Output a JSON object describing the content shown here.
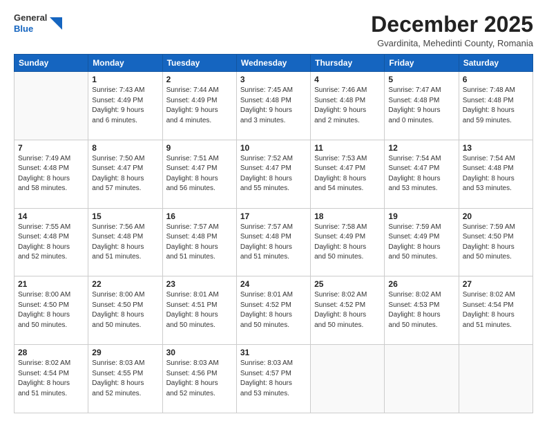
{
  "header": {
    "logo_line1": "General",
    "logo_line2": "Blue",
    "month_title": "December 2025",
    "location": "Gvardinita, Mehedinti County, Romania"
  },
  "weekdays": [
    "Sunday",
    "Monday",
    "Tuesday",
    "Wednesday",
    "Thursday",
    "Friday",
    "Saturday"
  ],
  "weeks": [
    [
      {
        "day": "",
        "info": ""
      },
      {
        "day": "1",
        "info": "Sunrise: 7:43 AM\nSunset: 4:49 PM\nDaylight: 9 hours\nand 6 minutes."
      },
      {
        "day": "2",
        "info": "Sunrise: 7:44 AM\nSunset: 4:49 PM\nDaylight: 9 hours\nand 4 minutes."
      },
      {
        "day": "3",
        "info": "Sunrise: 7:45 AM\nSunset: 4:48 PM\nDaylight: 9 hours\nand 3 minutes."
      },
      {
        "day": "4",
        "info": "Sunrise: 7:46 AM\nSunset: 4:48 PM\nDaylight: 9 hours\nand 2 minutes."
      },
      {
        "day": "5",
        "info": "Sunrise: 7:47 AM\nSunset: 4:48 PM\nDaylight: 9 hours\nand 0 minutes."
      },
      {
        "day": "6",
        "info": "Sunrise: 7:48 AM\nSunset: 4:48 PM\nDaylight: 8 hours\nand 59 minutes."
      }
    ],
    [
      {
        "day": "7",
        "info": "Sunrise: 7:49 AM\nSunset: 4:48 PM\nDaylight: 8 hours\nand 58 minutes."
      },
      {
        "day": "8",
        "info": "Sunrise: 7:50 AM\nSunset: 4:47 PM\nDaylight: 8 hours\nand 57 minutes."
      },
      {
        "day": "9",
        "info": "Sunrise: 7:51 AM\nSunset: 4:47 PM\nDaylight: 8 hours\nand 56 minutes."
      },
      {
        "day": "10",
        "info": "Sunrise: 7:52 AM\nSunset: 4:47 PM\nDaylight: 8 hours\nand 55 minutes."
      },
      {
        "day": "11",
        "info": "Sunrise: 7:53 AM\nSunset: 4:47 PM\nDaylight: 8 hours\nand 54 minutes."
      },
      {
        "day": "12",
        "info": "Sunrise: 7:54 AM\nSunset: 4:47 PM\nDaylight: 8 hours\nand 53 minutes."
      },
      {
        "day": "13",
        "info": "Sunrise: 7:54 AM\nSunset: 4:48 PM\nDaylight: 8 hours\nand 53 minutes."
      }
    ],
    [
      {
        "day": "14",
        "info": "Sunrise: 7:55 AM\nSunset: 4:48 PM\nDaylight: 8 hours\nand 52 minutes."
      },
      {
        "day": "15",
        "info": "Sunrise: 7:56 AM\nSunset: 4:48 PM\nDaylight: 8 hours\nand 51 minutes."
      },
      {
        "day": "16",
        "info": "Sunrise: 7:57 AM\nSunset: 4:48 PM\nDaylight: 8 hours\nand 51 minutes."
      },
      {
        "day": "17",
        "info": "Sunrise: 7:57 AM\nSunset: 4:48 PM\nDaylight: 8 hours\nand 51 minutes."
      },
      {
        "day": "18",
        "info": "Sunrise: 7:58 AM\nSunset: 4:49 PM\nDaylight: 8 hours\nand 50 minutes."
      },
      {
        "day": "19",
        "info": "Sunrise: 7:59 AM\nSunset: 4:49 PM\nDaylight: 8 hours\nand 50 minutes."
      },
      {
        "day": "20",
        "info": "Sunrise: 7:59 AM\nSunset: 4:50 PM\nDaylight: 8 hours\nand 50 minutes."
      }
    ],
    [
      {
        "day": "21",
        "info": "Sunrise: 8:00 AM\nSunset: 4:50 PM\nDaylight: 8 hours\nand 50 minutes."
      },
      {
        "day": "22",
        "info": "Sunrise: 8:00 AM\nSunset: 4:50 PM\nDaylight: 8 hours\nand 50 minutes."
      },
      {
        "day": "23",
        "info": "Sunrise: 8:01 AM\nSunset: 4:51 PM\nDaylight: 8 hours\nand 50 minutes."
      },
      {
        "day": "24",
        "info": "Sunrise: 8:01 AM\nSunset: 4:52 PM\nDaylight: 8 hours\nand 50 minutes."
      },
      {
        "day": "25",
        "info": "Sunrise: 8:02 AM\nSunset: 4:52 PM\nDaylight: 8 hours\nand 50 minutes."
      },
      {
        "day": "26",
        "info": "Sunrise: 8:02 AM\nSunset: 4:53 PM\nDaylight: 8 hours\nand 50 minutes."
      },
      {
        "day": "27",
        "info": "Sunrise: 8:02 AM\nSunset: 4:54 PM\nDaylight: 8 hours\nand 51 minutes."
      }
    ],
    [
      {
        "day": "28",
        "info": "Sunrise: 8:02 AM\nSunset: 4:54 PM\nDaylight: 8 hours\nand 51 minutes."
      },
      {
        "day": "29",
        "info": "Sunrise: 8:03 AM\nSunset: 4:55 PM\nDaylight: 8 hours\nand 52 minutes."
      },
      {
        "day": "30",
        "info": "Sunrise: 8:03 AM\nSunset: 4:56 PM\nDaylight: 8 hours\nand 52 minutes."
      },
      {
        "day": "31",
        "info": "Sunrise: 8:03 AM\nSunset: 4:57 PM\nDaylight: 8 hours\nand 53 minutes."
      },
      {
        "day": "",
        "info": ""
      },
      {
        "day": "",
        "info": ""
      },
      {
        "day": "",
        "info": ""
      }
    ]
  ]
}
